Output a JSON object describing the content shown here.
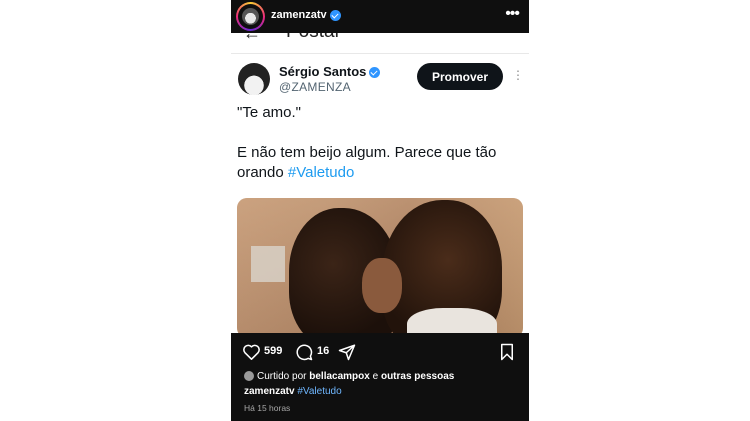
{
  "instagram": {
    "username": "zamenzatv",
    "likes": "599",
    "comments": "16",
    "liked_prefix": "Curtido por",
    "liked_user": "bellacampox",
    "liked_connector": "e",
    "liked_suffix": "outras pessoas",
    "caption_user": "zamenzatv",
    "caption_tag": "#Valetudo",
    "time": "Há 15 horas"
  },
  "tweet_header": {
    "title": "Postar"
  },
  "tweet": {
    "author_name": "Sérgio Santos",
    "handle": "@ZAMENZA",
    "promote_label": "Promover",
    "line1": "\"Te amo.\"",
    "line2_text": "E não tem beijo algum. Parece que tão orando ",
    "hashtag": "#Valetudo"
  },
  "icons": [
    "heart-icon",
    "comment-icon",
    "share-icon",
    "bookmark-icon",
    "more-icon",
    "verified-icon",
    "back-arrow-icon"
  ],
  "colors": {
    "hashtag": "#1d9bf0",
    "verified": "#2f95ff",
    "ig_bar": "#0f0f0f"
  }
}
